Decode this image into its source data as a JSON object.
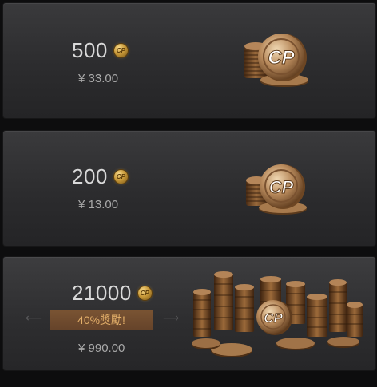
{
  "packages": [
    {
      "amount": "500",
      "price": "¥ 33.00",
      "coin_icon": "cp-coin-icon",
      "coin_text": "CP"
    },
    {
      "amount": "200",
      "price": "¥ 13.00",
      "coin_icon": "cp-coin-icon",
      "coin_text": "CP"
    },
    {
      "amount": "21000",
      "price": "¥ 990.00",
      "bonus": "40%獎勵!",
      "coin_icon": "cp-coin-icon",
      "coin_text": "CP"
    }
  ],
  "colors": {
    "background": "#0d0d0e",
    "card": "#2e2e30",
    "gold": "#c99a3a",
    "bonus_bg": "#6e4a2e",
    "bonus_text": "#e4b06a"
  }
}
